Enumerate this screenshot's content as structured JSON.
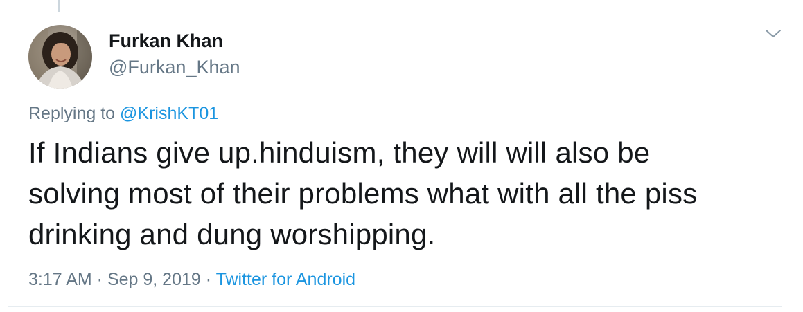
{
  "tweet": {
    "author": {
      "display_name": "Furkan Khan",
      "handle": "@Furkan_Khan"
    },
    "reply": {
      "prefix": "Replying to ",
      "to_handle": "@KrishKT01"
    },
    "text": "If Indians give up.hinduism, they will will also be\nsolving most of their problems what with all the piss\ndrinking and dung worshipping.",
    "meta": {
      "time": "3:17 AM",
      "separator": " · ",
      "date": "Sep 9, 2019",
      "source": "Twitter for Android"
    }
  },
  "icons": {
    "menu": "chevron-down-icon"
  },
  "colors": {
    "text_primary": "#14171a",
    "text_secondary": "#657786",
    "link": "#1b95e0",
    "divider": "#e6ecf0"
  }
}
